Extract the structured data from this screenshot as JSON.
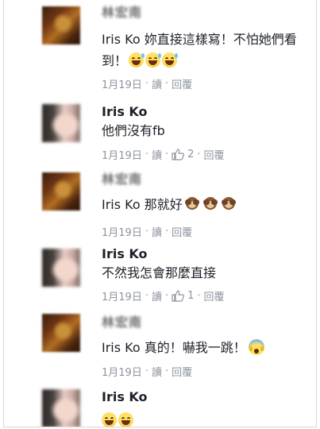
{
  "comments": [
    {
      "avatar": "man-avatar-blurred",
      "name": "林宏南",
      "text": "Iris Ko 妳直接這樣寫！不怕她們看到！",
      "emojis": [
        "grinning-sweat",
        "grinning-sweat",
        "grinning-sweat"
      ],
      "date": "1月19日",
      "read": "讀",
      "reply": "回覆"
    },
    {
      "avatar": "woman-avatar-blurred",
      "name": "Iris Ko",
      "text": "他們沒有fb",
      "date": "1月19日",
      "read": "讀",
      "like_count": "2",
      "reply": "回覆"
    },
    {
      "avatar": "man-avatar-blurred",
      "name": "林宏南",
      "text": "Iris Ko 那就好",
      "emojis": [
        "see-no-evil-monkey",
        "see-no-evil-monkey",
        "see-no-evil-monkey"
      ],
      "date": "1月19日",
      "read": "讀",
      "reply": "回覆"
    },
    {
      "avatar": "woman-avatar-blurred",
      "name": "Iris Ko",
      "text": "不然我怎會那麼直接",
      "date": "1月19日",
      "read": "讀",
      "like_count": "1",
      "reply": "回覆"
    },
    {
      "avatar": "man-avatar-blurred",
      "name": "林宏南",
      "text": "Iris Ko 真的！嚇我一跳！",
      "emojis": [
        "face-screaming-in-fear"
      ],
      "date": "1月19日",
      "read": "讀",
      "reply": "回覆"
    },
    {
      "avatar": "woman-avatar-blurred",
      "name": "Iris Ko",
      "emojis": [
        "tears-of-joy",
        "tears-of-joy"
      ]
    }
  ],
  "separator": "·",
  "icons": {
    "like": "thumbs-up-icon"
  },
  "colors": {
    "meta": "#8d949e",
    "name": "#1d2129",
    "text": "#1d2129"
  }
}
